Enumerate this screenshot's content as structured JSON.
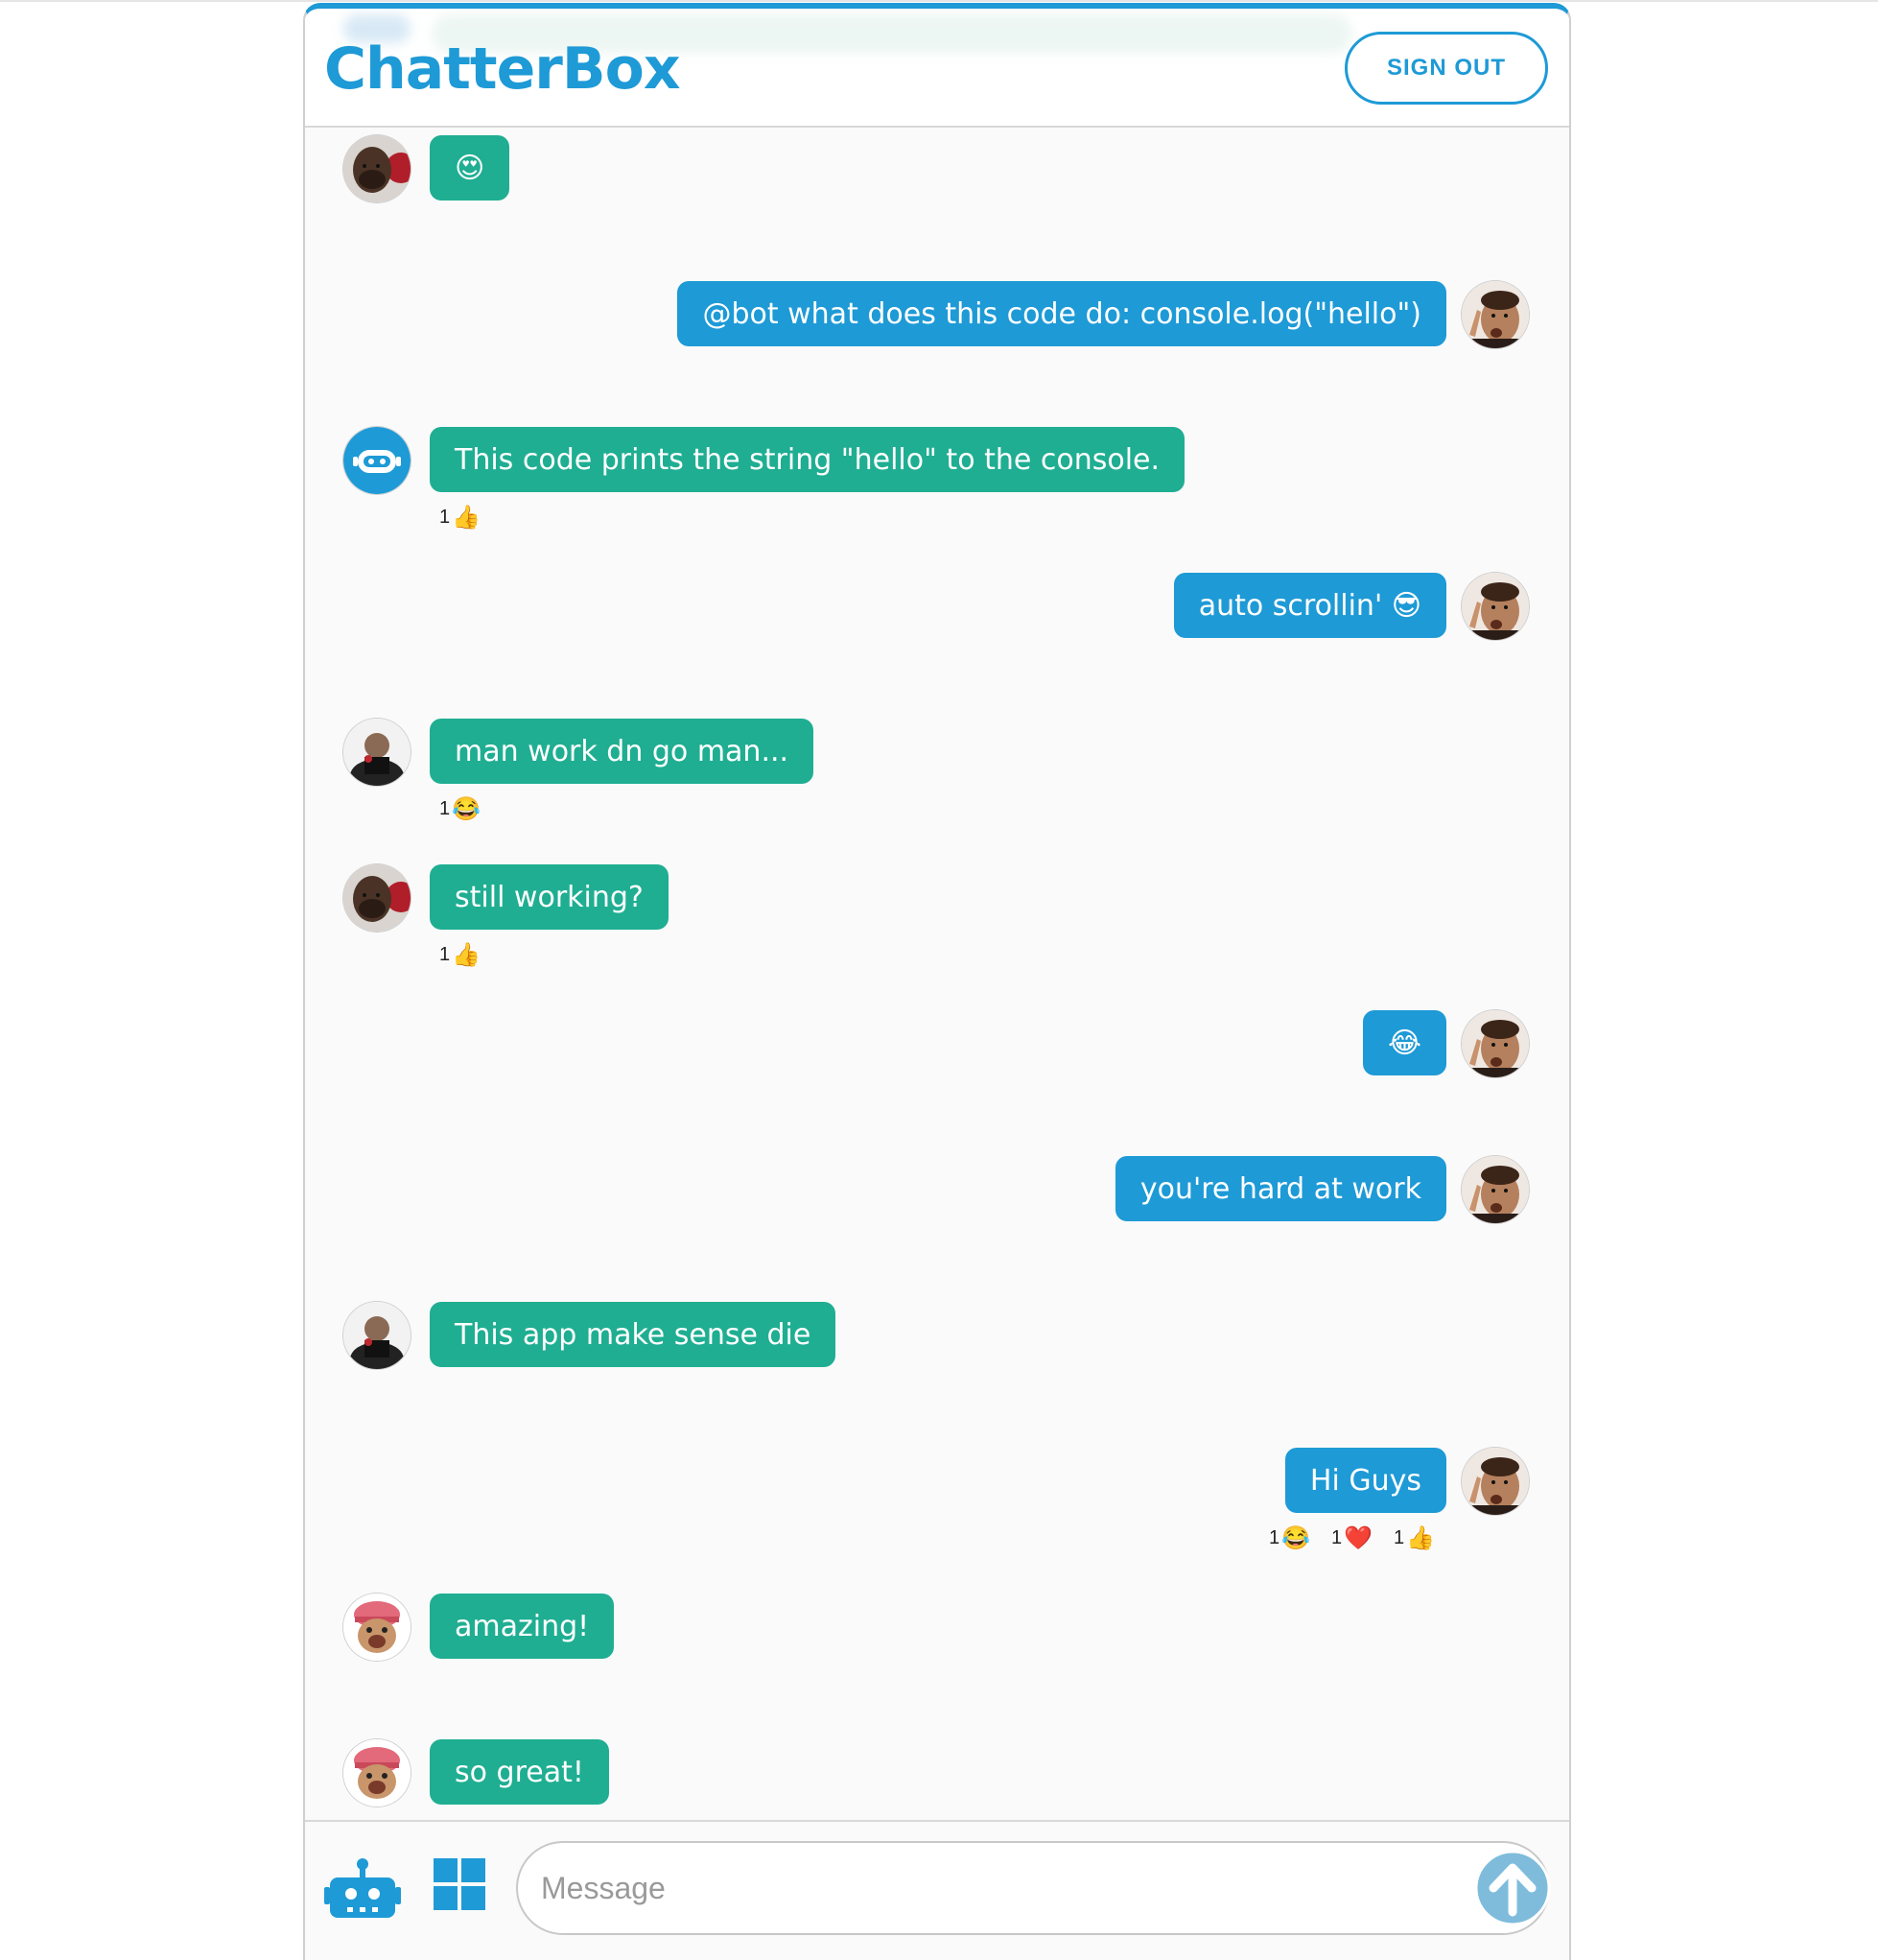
{
  "app": {
    "brand": "ChatterBox",
    "signout_label": "SIGN OUT",
    "accent_color": "#1e9ad6",
    "received_color": "#1fae92"
  },
  "messages": [
    {
      "side": "received",
      "avatar": "man-photo-avatar",
      "text": "😍",
      "reactions": []
    },
    {
      "side": "sent",
      "avatar": "user-photo-avatar",
      "text": "@bot what does this code do: console.log(\"hello\")",
      "reactions": []
    },
    {
      "side": "received",
      "avatar": "bot-avatar",
      "text": "This code prints the string \"hello\" to the console.",
      "reactions": [
        {
          "count": "1",
          "emoji": "👍"
        }
      ]
    },
    {
      "side": "sent",
      "avatar": "user-photo-avatar",
      "text": "auto scrollin' 😎",
      "reactions": []
    },
    {
      "side": "received",
      "avatar": "bw-photo-avatar",
      "text": "man work dn go man...",
      "reactions": [
        {
          "count": "1",
          "emoji": "😂"
        }
      ]
    },
    {
      "side": "received",
      "avatar": "man-photo-avatar",
      "text": "still working?",
      "reactions": [
        {
          "count": "1",
          "emoji": "👍"
        }
      ]
    },
    {
      "side": "sent",
      "avatar": "user-photo-avatar",
      "text": "😂",
      "reactions": []
    },
    {
      "side": "sent",
      "avatar": "user-photo-avatar",
      "text": "you're hard at work",
      "reactions": []
    },
    {
      "side": "received",
      "avatar": "bw-photo-avatar",
      "text": "This app make sense die",
      "reactions": []
    },
    {
      "side": "sent",
      "avatar": "user-photo-avatar",
      "text": "Hi Guys",
      "reactions": [
        {
          "count": "1",
          "emoji": "😂"
        },
        {
          "count": "1",
          "emoji": "❤️"
        },
        {
          "count": "1",
          "emoji": "👍"
        }
      ]
    },
    {
      "side": "received",
      "avatar": "cartoon-avatar",
      "text": "amazing!",
      "reactions": []
    },
    {
      "side": "received",
      "avatar": "cartoon-avatar",
      "text": "so great!",
      "reactions": []
    }
  ],
  "composer": {
    "placeholder": "Message",
    "bot_icon": "robot-icon",
    "grid_icon": "windows-grid-icon",
    "send_icon": "arrow-up-circle-icon"
  }
}
